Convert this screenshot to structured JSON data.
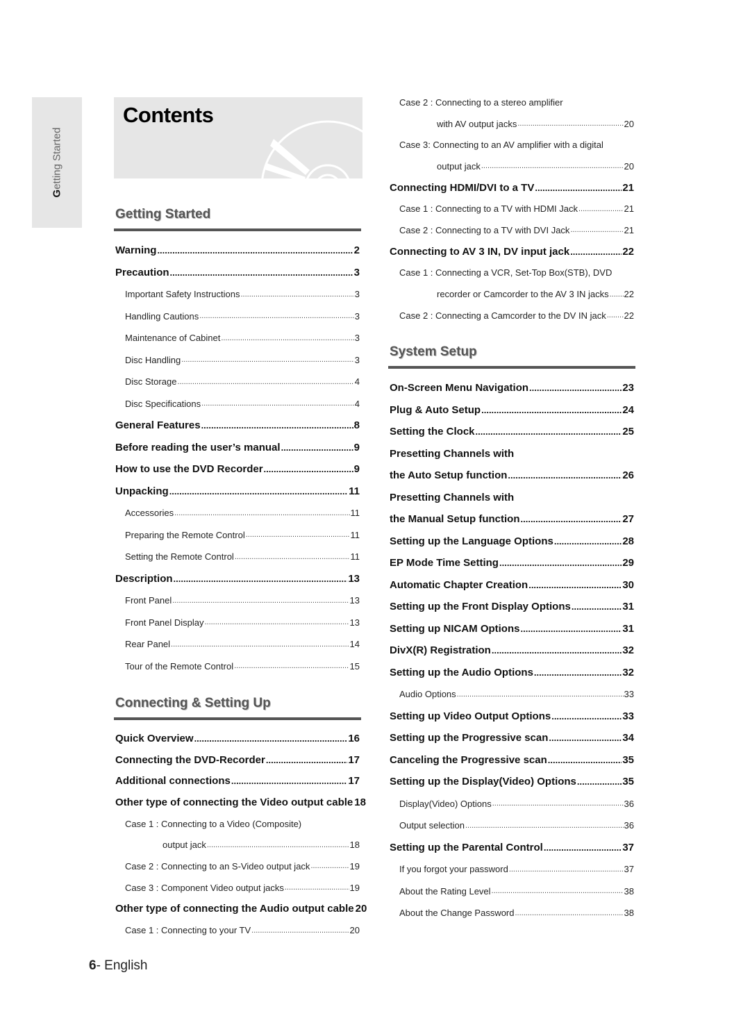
{
  "side_tab": {
    "label_first": "G",
    "label_rest": "etting Started"
  },
  "title": "Contents",
  "left": {
    "sections": [
      {
        "heading": "Getting Started",
        "entries": [
          {
            "level": "main",
            "text": "Warning",
            "page": "2"
          },
          {
            "level": "main",
            "text": "Precaution",
            "page": "3"
          },
          {
            "level": "sub",
            "text": "Important Safety Instructions",
            "page": "3"
          },
          {
            "level": "sub",
            "text": "Handling Cautions",
            "page": "3"
          },
          {
            "level": "sub",
            "text": "Maintenance of Cabinet",
            "page": "3"
          },
          {
            "level": "sub",
            "text": "Disc Handling",
            "page": "3"
          },
          {
            "level": "sub",
            "text": "Disc Storage",
            "page": "4"
          },
          {
            "level": "sub",
            "text": "Disc Specifications",
            "page": "4"
          },
          {
            "level": "main",
            "text": "General Features",
            "page": "8"
          },
          {
            "level": "main",
            "text": "Before reading the user’s manual ",
            "page": "9"
          },
          {
            "level": "main",
            "text": "How to use the DVD Recorder",
            "page": "9"
          },
          {
            "level": "main",
            "text": "Unpacking",
            "page": "11"
          },
          {
            "level": "sub",
            "text": "Accessories",
            "page": "11"
          },
          {
            "level": "sub",
            "text": "Preparing the Remote Control",
            "page": "11"
          },
          {
            "level": "sub",
            "text": "Setting the Remote Control",
            "page": "11"
          },
          {
            "level": "main",
            "text": "Description",
            "page": "13"
          },
          {
            "level": "sub",
            "text": "Front Panel",
            "page": "13"
          },
          {
            "level": "sub",
            "text": "Front Panel Display",
            "page": "13"
          },
          {
            "level": "sub",
            "text": "Rear Panel",
            "page": "14"
          },
          {
            "level": "sub",
            "text": "Tour of the Remote Control",
            "page": "15"
          }
        ]
      },
      {
        "heading": "Connecting & Setting Up",
        "entries": [
          {
            "level": "main",
            "text": "Quick Overview",
            "page": "16"
          },
          {
            "level": "main",
            "text": "Connecting the DVD-Recorder",
            "page": "17"
          },
          {
            "level": "main",
            "text": "Additional connections",
            "page": "17"
          },
          {
            "level": "main",
            "text": "Other type of connecting the Video output cable ",
            "page": "18"
          },
          {
            "level": "sub",
            "text": "Case 1 : Connecting to a Video (Composite)",
            "page": null
          },
          {
            "level": "cont",
            "text": "output jack",
            "page": "18"
          },
          {
            "level": "sub",
            "text": "Case 2 : Connecting to an S-Video output jack",
            "page": "19"
          },
          {
            "level": "sub",
            "text": "Case 3 : Component Video output jacks",
            "page": "19"
          },
          {
            "level": "main",
            "text": "Other type of connecting the Audio output cable",
            "page": "20"
          },
          {
            "level": "sub",
            "text": "Case 1 : Connecting to your TV",
            "page": "20"
          }
        ]
      }
    ]
  },
  "right": {
    "continued": [
      {
        "level": "sub",
        "text": "Case 2 : Connecting to a stereo amplifier",
        "page": null
      },
      {
        "level": "cont",
        "text": "with AV output jacks",
        "page": "20"
      },
      {
        "level": "sub",
        "text": "Case 3: Connecting to an AV amplifier with a digital",
        "page": null
      },
      {
        "level": "cont",
        "text": "output jack",
        "page": "20"
      },
      {
        "level": "main",
        "text": "Connecting HDMI/DVI to a TV",
        "page": "21"
      },
      {
        "level": "sub",
        "text": "Case 1 : Connecting to a TV with HDMI Jack ",
        "page": "21"
      },
      {
        "level": "sub",
        "text": "Case 2 : Connecting to a TV with DVI Jack ",
        "page": "21"
      },
      {
        "level": "main",
        "text": "Connecting to AV 3 IN, DV input jack",
        "page": "22"
      },
      {
        "level": "sub",
        "text": "Case 1 : Connecting a VCR, Set-Top Box(STB), DVD",
        "page": null
      },
      {
        "level": "cont",
        "text": "recorder or Camcorder to the AV 3 IN jacks",
        "page": "22"
      },
      {
        "level": "sub",
        "text": "Case 2 : Connecting a Camcorder to the DV IN jack ",
        "page": "22"
      }
    ],
    "sections": [
      {
        "heading": "System Setup",
        "entries": [
          {
            "level": "main",
            "text": "On-Screen Menu Navigation",
            "page": "23"
          },
          {
            "level": "main",
            "text": "Plug & Auto Setup ",
            "page": "24"
          },
          {
            "level": "main",
            "text": "Setting the Clock",
            "page": "25"
          },
          {
            "level": "main",
            "text": "Presetting Channels with",
            "page": null
          },
          {
            "level": "main",
            "text": "the Auto Setup function",
            "page": "26"
          },
          {
            "level": "main",
            "text": "Presetting Channels with",
            "page": null
          },
          {
            "level": "main",
            "text": "the Manual Setup function ",
            "page": "27"
          },
          {
            "level": "main",
            "text": "Setting up the Language Options",
            "page": "28"
          },
          {
            "level": "main",
            "text": "EP Mode Time Setting",
            "page": "29"
          },
          {
            "level": "main",
            "text": "Automatic Chapter Creation ",
            "page": "30"
          },
          {
            "level": "main",
            "text": "Setting up the Front Display Options",
            "page": "31"
          },
          {
            "level": "main",
            "text": "Setting up NICAM Options ",
            "page": "31"
          },
          {
            "level": "main",
            "text": "DivX(R) Registration",
            "page": "32"
          },
          {
            "level": "main",
            "text": "Setting up the Audio Options ",
            "page": "32"
          },
          {
            "level": "sub",
            "text": "Audio Options",
            "page": "33"
          },
          {
            "level": "main",
            "text": "Setting up Video Output Options",
            "page": "33"
          },
          {
            "level": "main",
            "text": "Setting up the Progressive scan",
            "page": "34"
          },
          {
            "level": "main",
            "text": "Canceling the Progressive scan ",
            "page": "35"
          },
          {
            "level": "main",
            "text": "Setting up the Display(Video) Options",
            "page": "35"
          },
          {
            "level": "sub",
            "text": "Display(Video) Options ",
            "page": "36"
          },
          {
            "level": "sub",
            "text": "Output selection ",
            "page": "36"
          },
          {
            "level": "main",
            "text": "Setting up the Parental Control",
            "page": "37"
          },
          {
            "level": "sub",
            "text": "If you forgot your password",
            "page": "37"
          },
          {
            "level": "sub",
            "text": "About the Rating Level ",
            "page": "38"
          },
          {
            "level": "sub",
            "text": "About the Change Password ",
            "page": "38"
          }
        ]
      }
    ]
  },
  "footer": {
    "page_number": "6",
    "language": "- English"
  }
}
